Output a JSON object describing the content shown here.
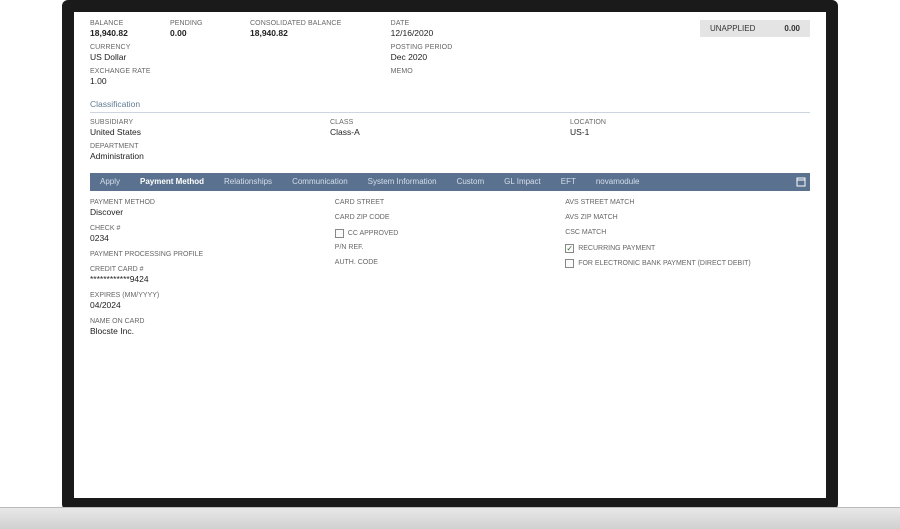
{
  "top": {
    "balance_label": "BALANCE",
    "balance": "18,940.82",
    "pending_label": "PENDING",
    "pending": "0.00",
    "consolidated_label": "CONSOLIDATED BALANCE",
    "consolidated": "18,940.82",
    "currency_label": "CURRENCY",
    "currency": "US Dollar",
    "exchange_label": "EXCHANGE RATE",
    "exchange": "1.00",
    "date_label": "DATE",
    "date": "12/16/2020",
    "posting_label": "POSTING PERIOD",
    "posting": "Dec 2020",
    "memo_label": "MEMO"
  },
  "unapplied": {
    "label": "UNAPPLIED",
    "value": "0.00"
  },
  "classification": {
    "title": "Classification",
    "subsidiary_label": "SUBSIDIARY",
    "subsidiary": "United States",
    "department_label": "DEPARTMENT",
    "department": "Administration",
    "class_label": "CLASS",
    "class": "Class-A",
    "location_label": "LOCATION",
    "location": "US-1"
  },
  "tabs": {
    "apply": "Apply",
    "payment_method": "Payment Method",
    "relationships": "Relationships",
    "communication": "Communication",
    "system_info": "System Information",
    "custom": "Custom",
    "gl_impact": "GL Impact",
    "eft": "EFT",
    "novamodule": "novamodule"
  },
  "pm": {
    "method_label": "PAYMENT METHOD",
    "method": "Discover",
    "check_label": "CHECK #",
    "check": "0234",
    "profile_label": "PAYMENT PROCESSING PROFILE",
    "cc_label": "CREDIT CARD #",
    "cc": "************9424",
    "expires_label": "EXPIRES (MM/YYYY)",
    "expires": "04/2024",
    "nameoncard_label": "NAME ON CARD",
    "nameoncard": "Blocste Inc.",
    "cardstreet_label": "CARD STREET",
    "cardzip_label": "CARD ZIP CODE",
    "ccapproved_label": "CC APPROVED",
    "pnref_label": "P/N REF.",
    "authcode_label": "AUTH. CODE",
    "avsstreet_label": "AVS STREET MATCH",
    "avszip_label": "AVS ZIP MATCH",
    "csc_label": "CSC MATCH",
    "recurring_label": "RECURRING PAYMENT",
    "directdebit_label": "FOR ELECTRONIC BANK PAYMENT (DIRECT DEBIT)"
  }
}
